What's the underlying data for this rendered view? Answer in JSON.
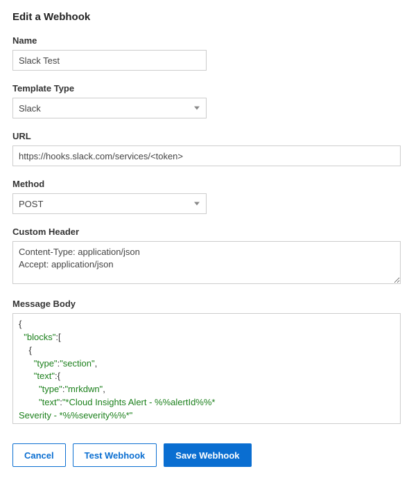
{
  "title": "Edit a Webhook",
  "fields": {
    "name": {
      "label": "Name",
      "value": "Slack Test"
    },
    "template_type": {
      "label": "Template Type",
      "value": "Slack"
    },
    "url": {
      "label": "URL",
      "value": "https://hooks.slack.com/services/<token>"
    },
    "method": {
      "label": "Method",
      "value": "POST"
    },
    "custom_header": {
      "label": "Custom Header",
      "value": "Content-Type: application/json\nAccept: application/json"
    },
    "message_body": {
      "label": "Message Body",
      "value": "{\n  \"blocks\":[\n    {\n      \"type\":\"section\",\n      \"text\":{\n        \"type\":\"mrkdwn\",\n        \"text\":\"*Cloud Insights Alert - %%alertId%%*\nSeverity - *%%severity%%*\"\n      }\n    },\n    {"
    }
  },
  "buttons": {
    "cancel": "Cancel",
    "test": "Test Webhook",
    "save": "Save Webhook"
  }
}
